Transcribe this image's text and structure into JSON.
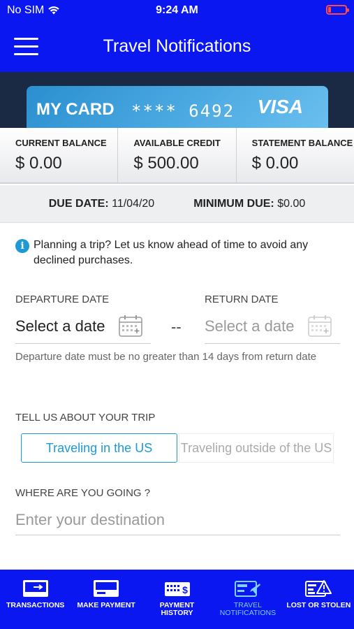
{
  "status_bar": {
    "carrier": "No SIM",
    "time": "9:24 AM"
  },
  "header": {
    "title": "Travel Notifications"
  },
  "card": {
    "label": "MY CARD",
    "masked_number": "**** 6492",
    "brand": "VISA"
  },
  "balances": [
    {
      "label": "CURRENT BALANCE",
      "value": "$ 0.00"
    },
    {
      "label": "AVAILABLE CREDIT",
      "value": "$ 500.00"
    },
    {
      "label": "STATEMENT BALANCE",
      "value": "$ 0.00"
    }
  ],
  "due": {
    "date_label": "DUE DATE:",
    "date_value": "11/04/20",
    "min_label": "MINIMUM DUE:",
    "min_value": "$0.00"
  },
  "info": {
    "text": "Planning a trip? Let us know ahead of time to avoid any declined purchases."
  },
  "dates": {
    "departure_label": "DEPARTURE DATE",
    "departure_value": "Select a date",
    "separator": "--",
    "return_label": "RETURN DATE",
    "return_value": "Select a date",
    "helper": "Departure date must be no greater than 14 days from return date"
  },
  "trip": {
    "label": "TELL US ABOUT YOUR TRIP",
    "options": [
      "Traveling in the US",
      "Traveling outside of the US"
    ],
    "selected": "Traveling in the US"
  },
  "destination": {
    "label": "WHERE ARE YOU GOING ?",
    "placeholder": "Enter your destination"
  },
  "tabs": [
    {
      "label": "TRANSACTIONS",
      "icon": "transactions-icon"
    },
    {
      "label": "MAKE PAYMENT",
      "icon": "card-icon"
    },
    {
      "label": "PAYMENT HISTORY",
      "icon": "payment-history-icon"
    },
    {
      "label": "TRAVEL NOTIFICATIONS",
      "icon": "travel-icon"
    },
    {
      "label": "LOST OR STOLEN",
      "icon": "alert-card-icon"
    }
  ],
  "colors": {
    "primary": "#0b17f0",
    "accent": "#1d9ad6",
    "active_tab": "#7fd0ff",
    "battery": "#ff4a4a"
  }
}
